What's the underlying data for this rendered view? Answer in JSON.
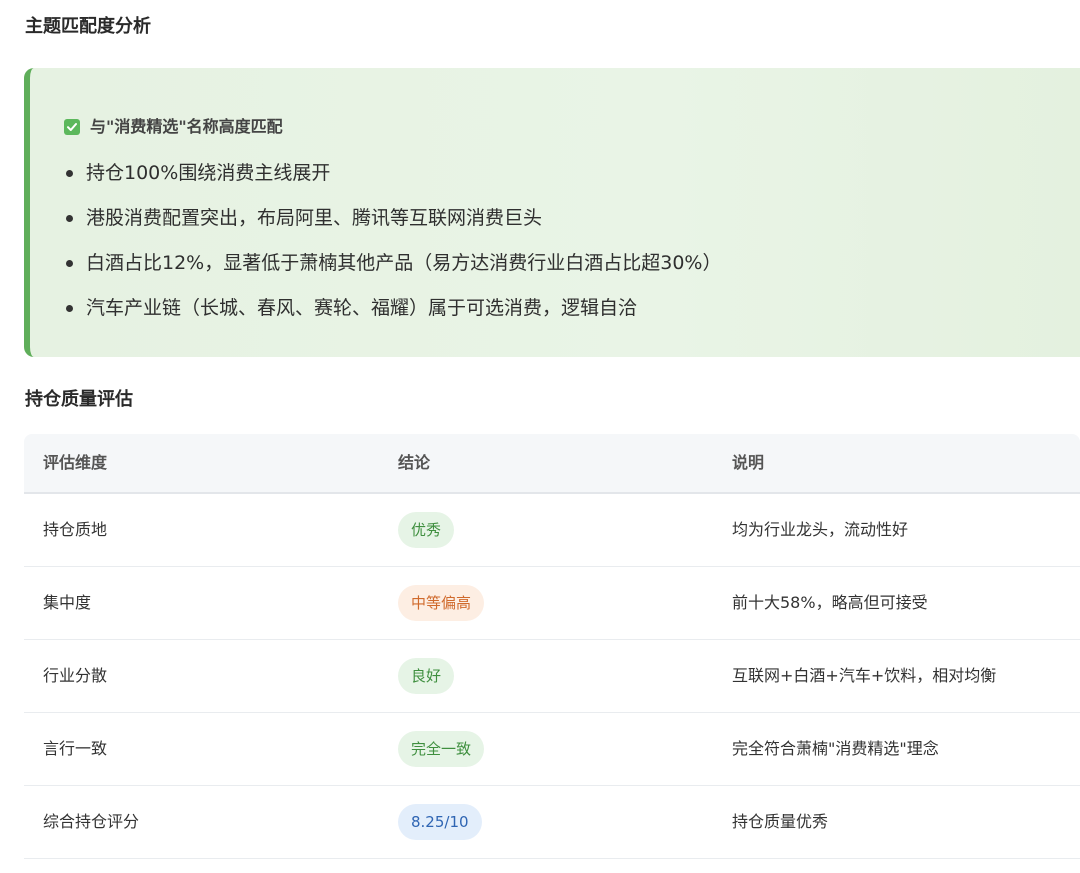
{
  "section1": {
    "title": "主题匹配度分析",
    "callout": {
      "heading": "与\"消费精选\"名称高度匹配",
      "check_icon": "check-mark-icon",
      "accent_color": "#5fae5a",
      "bullets": [
        "持仓100%围绕消费主线展开",
        "港股消费配置突出，布局阿里、腾讯等互联网消费巨头",
        "白酒占比12%，显著低于萧楠其他产品（易方达消费行业白酒占比超30%）",
        "汽车产业链（长城、春风、赛轮、福耀）属于可选消费，逻辑自洽"
      ]
    }
  },
  "section2": {
    "title": "持仓质量评估",
    "table": {
      "headers": [
        "评估维度",
        "结论",
        "说明"
      ],
      "rows": [
        {
          "dimension": "持仓质地",
          "conclusion": "优秀",
          "note": "均为行业龙头，流动性好",
          "badge_bg": "#e6f4e6",
          "badge_color": "#3f8f3f"
        },
        {
          "dimension": "集中度",
          "conclusion": "中等偏高",
          "note": "前十大58%，略高但可接受",
          "badge_bg": "#fdeee3",
          "badge_color": "#d06a2c"
        },
        {
          "dimension": "行业分散",
          "conclusion": "良好",
          "note": "互联网+白酒+汽车+饮料，相对均衡",
          "badge_bg": "#e6f4e6",
          "badge_color": "#3f8f3f"
        },
        {
          "dimension": "言行一致",
          "conclusion": "完全一致",
          "note": "完全符合萧楠\"消费精选\"理念",
          "badge_bg": "#e6f4e6",
          "badge_color": "#3f8f3f"
        },
        {
          "dimension": "综合持仓评分",
          "conclusion": "8.25/10",
          "note": "持仓质量优秀",
          "badge_bg": "#e3eefb",
          "badge_color": "#2f65b3"
        }
      ]
    }
  }
}
